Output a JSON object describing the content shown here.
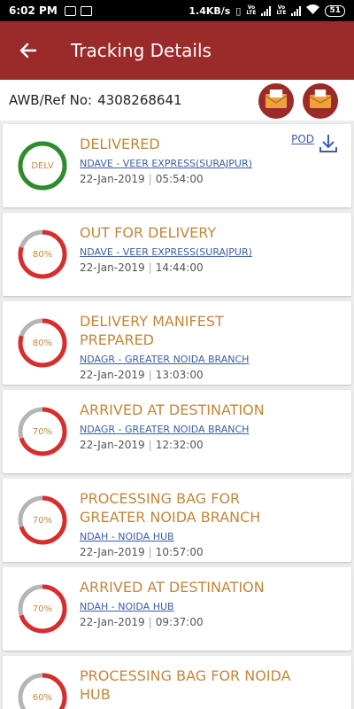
{
  "status_bar": {
    "time": "6:02 PM",
    "net_speed": "1.4KB/s",
    "battery": "51"
  },
  "header": {
    "title": "Tracking Details"
  },
  "ref": {
    "label": "AWB/Ref No:",
    "value": "4308268641"
  },
  "pod_label": "POD",
  "events": [
    {
      "status_lines": [
        "DELIVERED"
      ],
      "branch": "NDAVE - VEER EXPRESS(SURAJPUR)",
      "date": "22-Jan-2019",
      "time": "05:54:00",
      "badge": "DELV",
      "progress": 100,
      "color": "#2e8b2e"
    },
    {
      "status_lines": [
        "OUT FOR DELIVERY"
      ],
      "branch": "NDAVE - VEER EXPRESS(SURAJPUR)",
      "date": "22-Jan-2019",
      "time": "14:44:00",
      "badge": "80%",
      "progress": 80,
      "color": "#d92d2d"
    },
    {
      "status_lines": [
        "DELIVERY MANIFEST PREPARED"
      ],
      "branch": "NDAGR - GREATER NOIDA BRANCH",
      "date": "22-Jan-2019",
      "time": "13:03:00",
      "badge": "80%",
      "progress": 80,
      "color": "#d92d2d"
    },
    {
      "status_lines": [
        "ARRIVED AT DESTINATION"
      ],
      "branch": "NDAGR - GREATER NOIDA BRANCH",
      "date": "22-Jan-2019",
      "time": "12:32:00",
      "badge": "70%",
      "progress": 70,
      "color": "#d92d2d"
    },
    {
      "status_lines": [
        "PROCESSING BAG FOR",
        "GREATER NOIDA BRANCH"
      ],
      "branch": "NDAH - NOIDA HUB",
      "date": "22-Jan-2019",
      "time": "10:57:00",
      "badge": "70%",
      "progress": 70,
      "color": "#d92d2d"
    },
    {
      "status_lines": [
        "ARRIVED AT DESTINATION"
      ],
      "branch": "NDAH - NOIDA HUB",
      "date": "22-Jan-2019",
      "time": "09:37:00",
      "badge": "70%",
      "progress": 70,
      "color": "#d92d2d"
    },
    {
      "status_lines": [
        "PROCESSING BAG FOR NOIDA",
        "HUB"
      ],
      "branch": "",
      "date": "",
      "time": "",
      "badge": "60%",
      "progress": 60,
      "color": "#d92d2d"
    }
  ],
  "colors": {
    "brand": "#9b2b2b",
    "accent_text": "#c2873a",
    "link": "#3a5ea8",
    "ring_track": "#b5b5b5"
  }
}
